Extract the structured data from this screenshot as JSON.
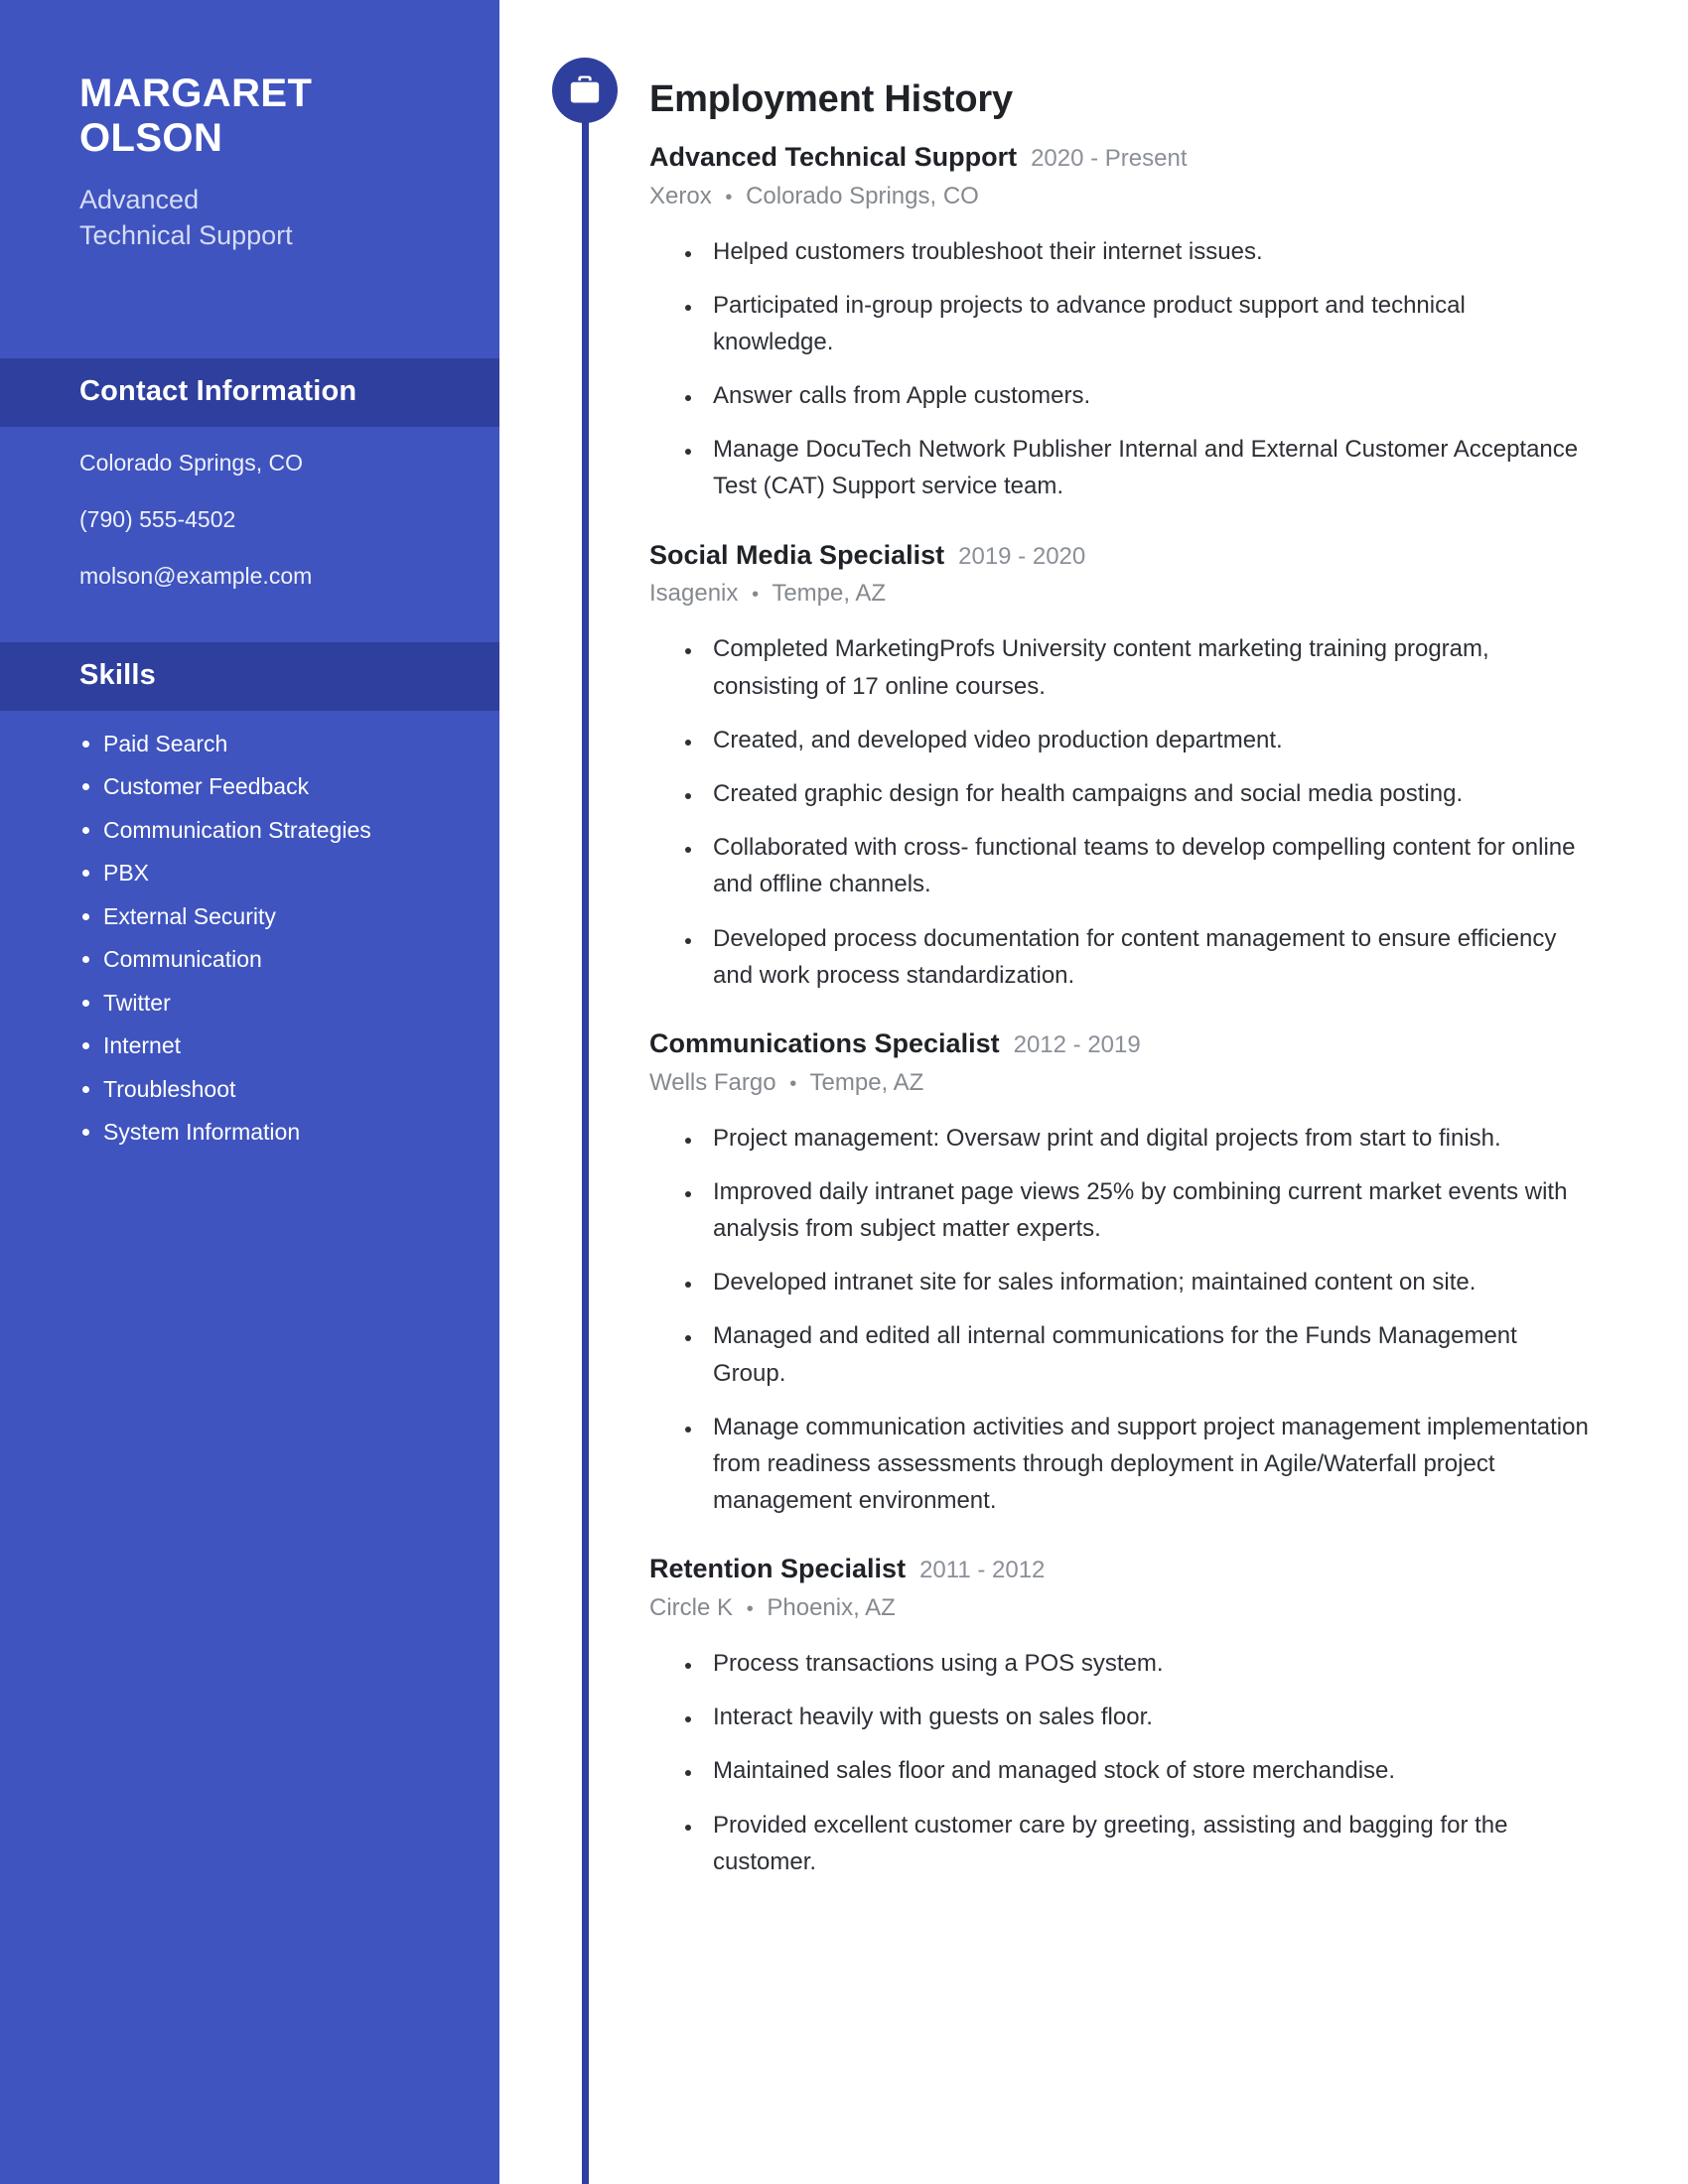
{
  "sidebar": {
    "name": "MARGARET\nOLSON",
    "name_line1": "MARGARET",
    "name_line2": "OLSON",
    "role_line1": "Advanced",
    "role_line2": "Technical Support",
    "contact_heading": "Contact Information",
    "contact": [
      "Colorado Springs, CO",
      "(790) 555-4502",
      "molson@example.com"
    ],
    "skills_heading": "Skills",
    "skills": [
      "Paid Search",
      "Customer Feedback",
      "Communication Strategies",
      "PBX",
      "External Security",
      "Communication",
      "Twitter",
      "Internet",
      "Troubleshoot",
      "System Information"
    ]
  },
  "main": {
    "section_title": "Employment History",
    "section_icon": "briefcase-icon",
    "jobs": [
      {
        "title": "Advanced Technical Support",
        "dates": "2020 - Present",
        "company": "Xerox",
        "location": "Colorado Springs, CO",
        "bullets": [
          "Helped customers troubleshoot their internet issues.",
          "Participated in-group projects to advance product support and technical knowledge.",
          "Answer calls from Apple customers.",
          "Manage DocuTech Network Publisher Internal and External Customer Acceptance Test (CAT) Support service team."
        ]
      },
      {
        "title": "Social Media Specialist",
        "dates": "2019 - 2020",
        "company": "Isagenix",
        "location": "Tempe, AZ",
        "bullets": [
          "Completed MarketingProfs University content marketing training program, consisting of 17 online courses.",
          "Created, and developed video production department.",
          "Created graphic design for health campaigns and social media posting.",
          "Collaborated with cross- functional teams to develop compelling content for online and offline channels.",
          "Developed process documentation for content management to ensure efficiency and work process standardization."
        ]
      },
      {
        "title": "Communications Specialist",
        "dates": "2012 - 2019",
        "company": "Wells Fargo",
        "location": "Tempe, AZ",
        "bullets": [
          "Project management: Oversaw print and digital projects from start to finish.",
          "Improved daily intranet page views 25% by combining current market events with analysis from subject matter experts.",
          "Developed intranet site for sales information; maintained content on site.",
          "Managed and edited all internal communications for the Funds Management Group.",
          "Manage communication activities and support project management implementation from readiness assessments through deployment in Agile/Waterfall project management environment."
        ]
      },
      {
        "title": "Retention Specialist",
        "dates": "2011 - 2012",
        "company": "Circle K",
        "location": "Phoenix, AZ",
        "bullets": [
          "Process transactions using a POS system.",
          "Interact heavily with guests on sales floor.",
          "Maintained sales floor and managed stock of store merchandise.",
          "Provided excellent customer care by greeting, assisting and bagging for the customer."
        ]
      }
    ],
    "separator": "•"
  },
  "colors": {
    "sidebar_bg": "#3f54bf",
    "sidebar_band_bg": "#2f3f9e",
    "accent": "#2f3f9e",
    "heading_text": "#1f2227",
    "body_text": "#2d3036",
    "muted_text": "#85898f"
  }
}
